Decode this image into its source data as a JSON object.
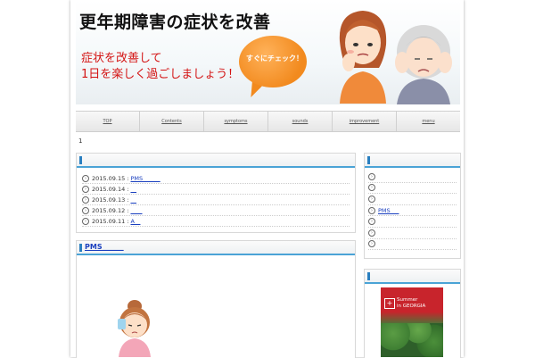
{
  "banner": {
    "title": "更年期障害の症状を改善",
    "subtitle_line1": "症状を改善して",
    "subtitle_line2": "1日を楽しく過ごしましょう！",
    "bubble_text": "すぐにチェック！"
  },
  "nav": {
    "items": [
      "TOP",
      "Contents",
      "symptoms",
      "sounds",
      "improvement",
      "menu"
    ]
  },
  "breadcrumb": "1",
  "news": {
    "rows": [
      {
        "date": "2015.09.15 :",
        "link": "PMS______"
      },
      {
        "date": "2015.09.14 :",
        "link": "__"
      },
      {
        "date": "2015.09.13 :",
        "link": "__"
      },
      {
        "date": "2015.09.12 :",
        "link": "____"
      },
      {
        "date": "2015.09.11 :",
        "link": "A__"
      }
    ]
  },
  "article": {
    "title": "PMS______"
  },
  "sidebar": {
    "rows": [
      "",
      "",
      "",
      "PMS___",
      "",
      "",
      ""
    ]
  },
  "ad": {
    "line1": "Summer",
    "line2": "in GEORGIA",
    "logo": "+"
  },
  "colors": {
    "accent": "#4aa3d6",
    "link": "#1a3fbf",
    "banner_text": "#d41414",
    "bubble": "#f28a1e"
  }
}
